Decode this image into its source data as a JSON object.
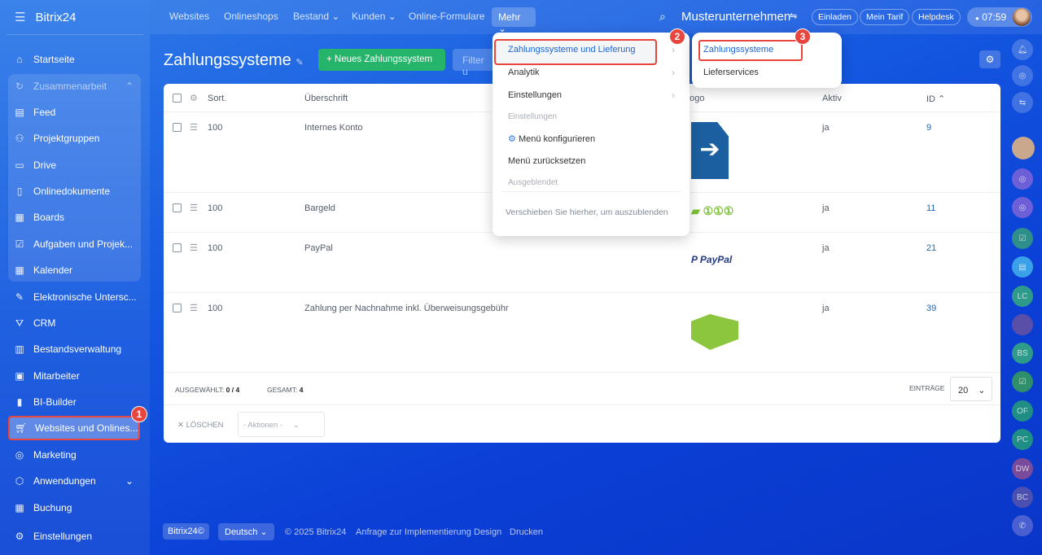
{
  "app": {
    "logo": "Bitrix24",
    "logo_mark": "©"
  },
  "sidebar": {
    "items": [
      {
        "label": "Startseite",
        "icon": "home-icon"
      },
      {
        "label": "Zusammenarbeit",
        "icon": "collab-icon"
      },
      {
        "label": "Feed",
        "icon": "feed-icon"
      },
      {
        "label": "Projektgruppen",
        "icon": "groups-icon"
      },
      {
        "label": "Drive",
        "icon": "drive-icon"
      },
      {
        "label": "Onlinedokumente",
        "icon": "document-icon"
      },
      {
        "label": "Boards",
        "icon": "board-icon"
      },
      {
        "label": "Aufgaben und Projek...",
        "icon": "tasks-icon"
      },
      {
        "label": "Kalender",
        "icon": "calendar-icon"
      },
      {
        "label": "Elektronische Untersc...",
        "icon": "signature-icon"
      },
      {
        "label": "CRM",
        "icon": "crm-icon"
      },
      {
        "label": "Bestandsverwaltung",
        "icon": "inventory-icon"
      },
      {
        "label": "Mitarbeiter",
        "icon": "employees-icon"
      },
      {
        "label": "BI-Builder",
        "icon": "chart-icon"
      },
      {
        "label": "Websites und Onlines...",
        "icon": "cart-icon"
      },
      {
        "label": "Marketing",
        "icon": "marketing-icon"
      },
      {
        "label": "Anwendungen",
        "icon": "apps-icon"
      },
      {
        "label": "Buchung",
        "icon": "booking-icon"
      },
      {
        "label": "Einstellungen",
        "icon": "settings-icon"
      }
    ]
  },
  "topnav": {
    "items": [
      "Websites",
      "Onlineshops",
      "Bestand ⌄",
      "Kunden ⌄",
      "Online-Formulare"
    ],
    "more": "Mehr ⌄",
    "company": "Musterunternehmen",
    "invite": "Einladen",
    "tariff": "Mein Tarif",
    "helpdesk": "Helpdesk",
    "time": "07:59"
  },
  "page": {
    "title": "Zahlungssysteme",
    "new_button": "+ Neues Zahlungssystem",
    "filter_placeholder": "Filter u"
  },
  "table": {
    "headers": {
      "sort": "Sort.",
      "title": "Überschrift",
      "logo": "Logo",
      "active": "Aktiv",
      "id": "ID ⌃"
    },
    "rows": [
      {
        "sort": "100",
        "title": "Internes Konto",
        "active": "ja",
        "id": "9"
      },
      {
        "sort": "100",
        "title": "Bargeld",
        "active": "ja",
        "id": "11"
      },
      {
        "sort": "100",
        "title": "PayPal",
        "active": "ja",
        "id": "21"
      },
      {
        "sort": "100",
        "title": "Zahlung per Nachnahme inkl. Überweisungsgebühr",
        "active": "ja",
        "id": "39"
      }
    ],
    "paypal_logo": "PayPal",
    "selected_label": "Ausgewählt:",
    "selected_value": "0 / 4",
    "total_label": "Gesamt:",
    "total_value": "4",
    "entries_label": "Einträge",
    "entries_value": "20",
    "delete": "Löschen",
    "actions": "- Aktionen -"
  },
  "menu": {
    "items": [
      "Zahlungssysteme und Lieferung",
      "Analytik",
      "Einstellungen"
    ],
    "section_settings": "Einstellungen",
    "configure": "Menü konfigurieren",
    "reset": "Menü zurücksetzen",
    "hidden": "Ausgeblendet",
    "drop_hint": "Verschieben Sie hierher, um auszublenden"
  },
  "submenu": {
    "items": [
      "Zahlungssysteme",
      "Lieferservices"
    ]
  },
  "badges": [
    "1",
    "2",
    "3"
  ],
  "rail": [
    "LC",
    "BS",
    "OF",
    "PC",
    "DW",
    "BC"
  ],
  "footer": {
    "logo": "Bitrix24©",
    "language": "Deutsch ⌄",
    "copyright": "© 2025 Bitrix24",
    "links": [
      "Anfrage zur Implementierung",
      "Design",
      "Drucken"
    ]
  }
}
